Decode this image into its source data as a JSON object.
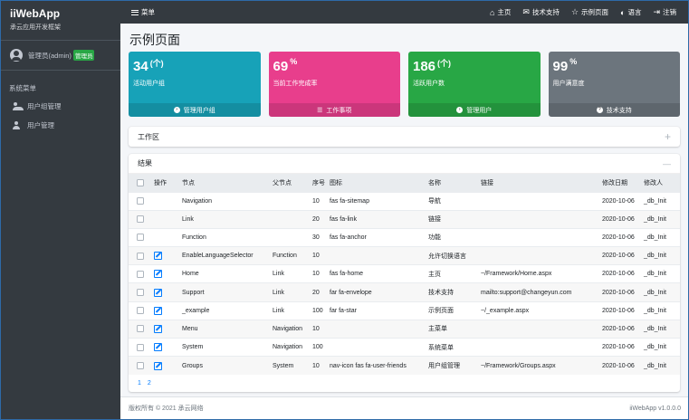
{
  "app": {
    "name": "iiWebApp",
    "subtitle": "承云应用开发框架",
    "version": "iiWebApp v1.0.0.0",
    "copyright": "版权所有 © 2021 承云网络"
  },
  "user": {
    "name": "管理员(admin)",
    "badge": "管理员"
  },
  "sidebar": {
    "header": "系统菜单",
    "items": [
      {
        "label": "用户组管理",
        "icon": "users-icon"
      },
      {
        "label": "用户管理",
        "icon": "user-cog-icon"
      }
    ]
  },
  "topbar": {
    "menu_label": "菜单",
    "links": [
      {
        "label": "主页",
        "glyph": "⌂"
      },
      {
        "label": "技术支持",
        "glyph": "✉"
      },
      {
        "label": "示例页面",
        "glyph": "☆"
      },
      {
        "label": "语言",
        "glyph": "◐"
      },
      {
        "label": "注销",
        "glyph": "⇥"
      }
    ]
  },
  "page_title": "示例页面",
  "boxes": [
    {
      "value": "34",
      "unit": "(个)",
      "label": "活动用户组",
      "footer": "管理用户组",
      "color": "#17a2b8"
    },
    {
      "value": "69",
      "unit": "%",
      "label": "当前工作完成率",
      "footer": "工作事项",
      "color": "#e83e8c"
    },
    {
      "value": "186",
      "unit": "(个)",
      "label": "活跃用户数",
      "footer": "管理用户",
      "color": "#28a745"
    },
    {
      "value": "99",
      "unit": "%",
      "label": "用户满意度",
      "footer": "技术支持",
      "color": "#6c757d"
    }
  ],
  "workarea": {
    "title": "工作区",
    "tool": "+"
  },
  "results": {
    "title": "结果",
    "tool": "—",
    "columns": [
      "操作",
      "节点",
      "父节点",
      "序号",
      "图标",
      "名称",
      "链接",
      "修改日期",
      "修改人"
    ],
    "rows": [
      {
        "edit": false,
        "node": "Navigation",
        "parent": "",
        "order": "10",
        "icon": "fas fa-sitemap",
        "name": "导航",
        "link": "",
        "date": "2020-10-06",
        "by": "_db_Init"
      },
      {
        "edit": false,
        "node": "Link",
        "parent": "",
        "order": "20",
        "icon": "fas fa-link",
        "name": "链接",
        "link": "",
        "date": "2020-10-06",
        "by": "_db_Init"
      },
      {
        "edit": false,
        "node": "Function",
        "parent": "",
        "order": "30",
        "icon": "fas fa-anchor",
        "name": "功能",
        "link": "",
        "date": "2020-10-06",
        "by": "_db_Init"
      },
      {
        "edit": true,
        "node": "EnableLanguageSelector",
        "parent": "Function",
        "order": "10",
        "icon": "",
        "name": "允许切换语言",
        "link": "",
        "date": "2020-10-06",
        "by": "_db_Init"
      },
      {
        "edit": true,
        "node": "Home",
        "parent": "Link",
        "order": "10",
        "icon": "fas fa-home",
        "name": "主页",
        "link": "~/Framework/Home.aspx",
        "date": "2020-10-06",
        "by": "_db_Init"
      },
      {
        "edit": true,
        "node": "Support",
        "parent": "Link",
        "order": "20",
        "icon": "far fa-envelope",
        "name": "技术支持",
        "link": "mailto:support@changeyun.com",
        "date": "2020-10-06",
        "by": "_db_Init"
      },
      {
        "edit": true,
        "node": "_example",
        "parent": "Link",
        "order": "100",
        "icon": "far fa-star",
        "name": "示例页面",
        "link": "~/_example.aspx",
        "date": "2020-10-06",
        "by": "_db_Init"
      },
      {
        "edit": true,
        "node": "Menu",
        "parent": "Navigation",
        "order": "10",
        "icon": "",
        "name": "主菜单",
        "link": "",
        "date": "2020-10-06",
        "by": "_db_Init"
      },
      {
        "edit": true,
        "node": "System",
        "parent": "Navigation",
        "order": "100",
        "icon": "",
        "name": "系统菜单",
        "link": "",
        "date": "2020-10-06",
        "by": "_db_Init"
      },
      {
        "edit": true,
        "node": "Groups",
        "parent": "System",
        "order": "10",
        "icon": "nav-icon fas fa-user-friends",
        "name": "用户组管理",
        "link": "~/Framework/Groups.aspx",
        "date": "2020-10-06",
        "by": "_db_Init"
      }
    ],
    "pages": [
      "1",
      "2"
    ]
  }
}
